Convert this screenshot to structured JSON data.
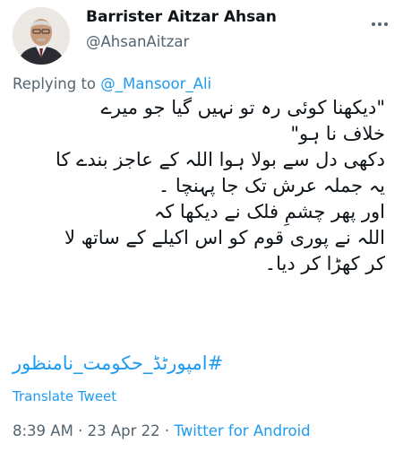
{
  "author": {
    "name": "Barrister Aitzar Ahsan",
    "handle": "@AhsanAitzar"
  },
  "reply": {
    "prefix": "Replying to",
    "mention": "@_Mansoor_Ali"
  },
  "tweet": {
    "lines": [
      "\"دیکھنا کوئی رہ تو نہیں گیا جو میرے",
      "خلاف نا ہو\"",
      "دکھی دل سے بولا ہوا اللہ کے عاجز بندے کا",
      "یہ جملہ عرش تک جا پہنچا ۔",
      "اور پھر چشمِ فلک نے دیکھا کہ",
      "اللہ نے پوری قوم کو اس اکیلے کے ساتھ لا",
      "کر کھڑا کر دیا۔"
    ],
    "hashtag": "#امپورٹڈ_حکومت_نامنظور"
  },
  "translate_label": "Translate Tweet",
  "meta": {
    "time": "8:39 AM",
    "date": "23 Apr 22",
    "separator": " · ",
    "app": "Twitter for Android"
  },
  "icons": {
    "more": "more-options-icon"
  },
  "colors": {
    "link": "#1d9bf0",
    "muted": "#536471",
    "text": "#0f1419"
  }
}
